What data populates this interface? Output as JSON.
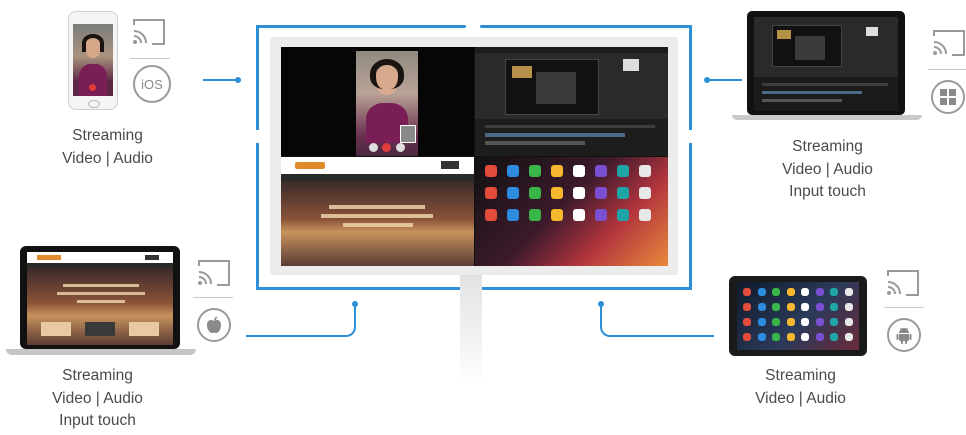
{
  "devices": {
    "iphone": {
      "os_icon": "ios-icon",
      "os_text": "iOS",
      "label_lines": [
        "Streaming",
        "Video | Audio"
      ]
    },
    "windows_laptop": {
      "os_icon": "windows-icon",
      "label_lines": [
        "Streaming",
        "Video | Audio",
        "Input touch"
      ]
    },
    "macbook": {
      "os_icon": "apple-icon",
      "label_lines": [
        "Streaming",
        "Video | Audio",
        "Input touch"
      ]
    },
    "android_tablet": {
      "os_icon": "android-icon",
      "label_lines": [
        "Streaming",
        "Video | Audio"
      ]
    }
  },
  "cast_icon": "cast-icon",
  "colors": {
    "accent": "#2e8fd6",
    "label_text": "#4a4a4a",
    "icon_gray": "#9a9a9a"
  }
}
